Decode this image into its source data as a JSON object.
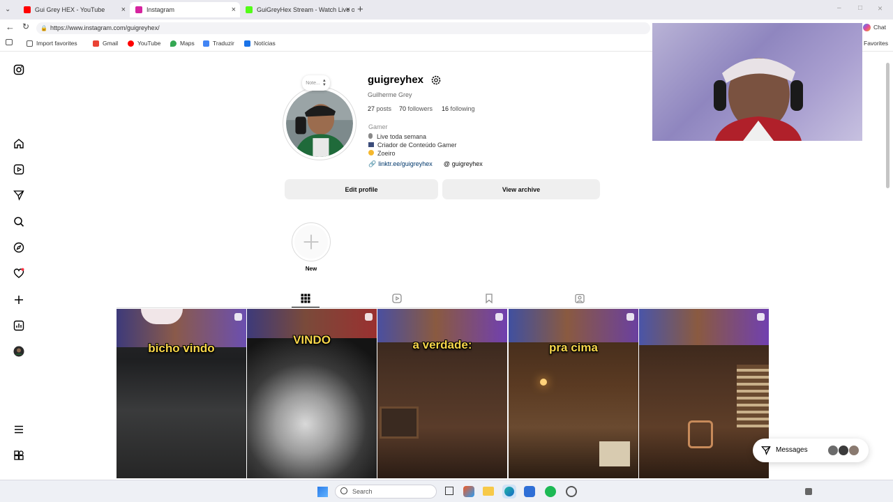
{
  "browser": {
    "tabs": [
      {
        "title": "Gui Grey HEX - YouTube",
        "color": "#ff0000",
        "active": false
      },
      {
        "title": "Instagram",
        "color": "#d6249f",
        "active": true
      },
      {
        "title": "GuiGreyHex Stream - Watch Live o",
        "color": "#53fc18",
        "active": false
      }
    ],
    "url": "https://www.instagram.com/guigreyhex/",
    "favorites": [
      "Import favorites",
      "Gmail",
      "YouTube",
      "Maps",
      "Traduzir",
      "Notícias"
    ],
    "chat": "Chat",
    "favorites_label": "Favorites"
  },
  "profile": {
    "note": "Note...",
    "username": "guigreyhex",
    "full_name": "Guilherme Grey",
    "posts_count": "27",
    "posts_label": "posts",
    "followers_count": "70",
    "followers_label": "followers",
    "following_count": "16",
    "following_label": "following",
    "category": "Gamer",
    "bio_lines": [
      "Live toda semana",
      "Criador de Conteúdo Gamer",
      "Zoeiro"
    ],
    "link": "linktr.ee/guigreyhex",
    "threads": "guigreyhex",
    "edit_profile": "Edit profile",
    "view_archive": "View archive",
    "new_highlight": "New"
  },
  "posts": [
    {
      "caption": "bicho vindo"
    },
    {
      "caption": "VINDO"
    },
    {
      "caption": "a verdade:"
    },
    {
      "caption": "pra cima"
    },
    {
      "caption": ""
    }
  ],
  "messages": {
    "label": "Messages"
  },
  "taskbar": {
    "search": "Search"
  },
  "colors": {
    "link": "#00376b",
    "button_bg": "#efefef",
    "caption": "#f7d64a"
  }
}
